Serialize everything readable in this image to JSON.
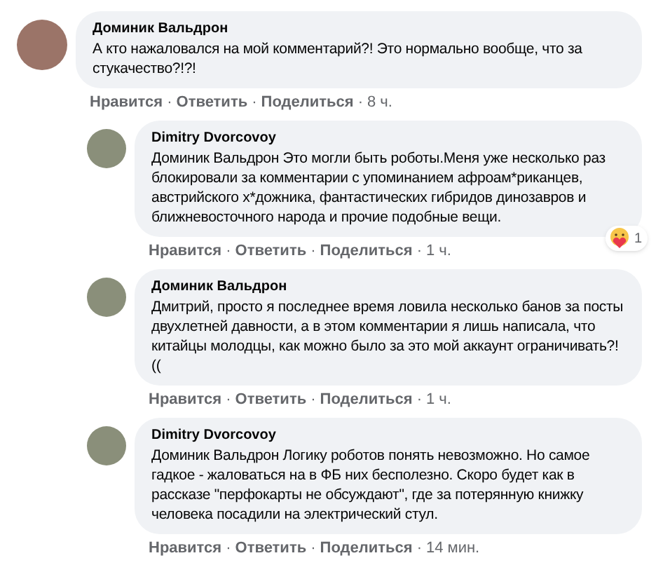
{
  "separator": "·",
  "comment": {
    "author": "Доминик Вальдрон",
    "text": "А кто нажаловался на мой комментарий?! Это нормально вообще, что за стукачество?!?!",
    "actions": [
      "Нравится",
      "Ответить",
      "Поделиться"
    ],
    "time": "8 ч.",
    "replies": [
      {
        "author": "Dimitry Dvorcovoy",
        "text": "Доминик Вальдрон Это могли быть роботы.Меня уже несколько раз блокировали за комментарии с упоминанием афроам*риканцев, австрийского х*дожника, фантастических гибридов динозавров и ближневосточного народа и прочие подобные вещи.",
        "reaction_count": "1",
        "actions": [
          "Нравится",
          "Ответить",
          "Поделиться"
        ],
        "time": "1 ч."
      },
      {
        "author": "Доминик Вальдрон",
        "text": "Дмитрий, просто я последнее время ловила несколько банов за посты двухлетней давности, а в этом комментарии я лишь написала, что китайцы молодцы, как можно было за это мой аккаунт ограничивать?!((",
        "actions": [
          "Нравится",
          "Ответить",
          "Поделиться"
        ],
        "time": "1 ч."
      },
      {
        "author": "Dimitry Dvorcovoy",
        "text": "Доминик Вальдрон Логику роботов понять невозможно. Но самое гадкое - жаловаться на в ФБ них бесполезно. Скоро будет как в рассказе \"перфокарты не обсуждают\", где за потерянную книжку человека посадили на электрический стул.",
        "actions": [
          "Нравится",
          "Ответить",
          "Поделиться"
        ],
        "time": "14 мин."
      }
    ]
  }
}
